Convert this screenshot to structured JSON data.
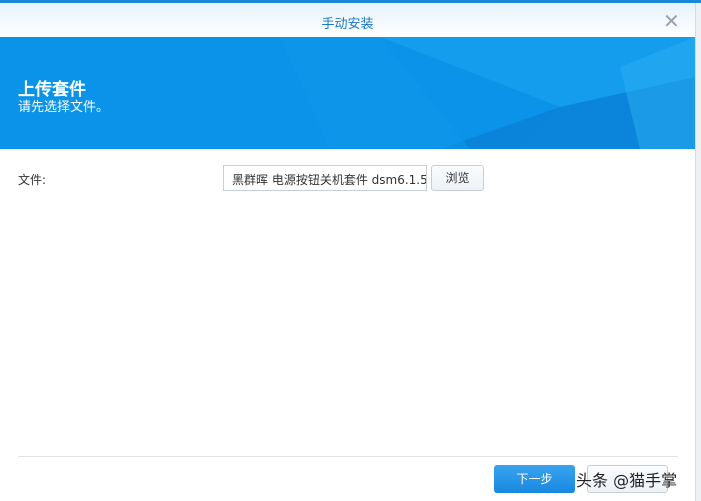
{
  "dialog": {
    "title": "手动安装",
    "close_icon": "close-icon"
  },
  "banner": {
    "heading": "上传套件",
    "subheading": "请先选择文件。",
    "color": "#0a93e8"
  },
  "form": {
    "file_label": "文件:",
    "file_value": "黑群晖 电源按钮关机套件 dsm6.1.5",
    "browse_label": "浏览"
  },
  "footer": {
    "next_label": "下一步",
    "cancel_label": ""
  },
  "watermark": "头条 @猫手掌"
}
